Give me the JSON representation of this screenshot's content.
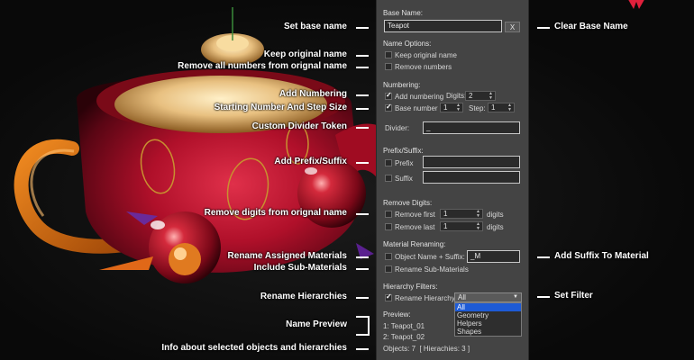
{
  "annotations_left": [
    "Set base name",
    "Keep original name",
    "Remove all numbers from orignal name",
    "Add Numbering",
    "Starting Number And Step Size",
    "Custom Divider Token",
    "Add Prefix/Suffix",
    "Remove digits from orignal name",
    "Rename Assigned Materials",
    "Include Sub-Materials",
    "Rename Hierarchies",
    "Name Preview",
    "Info about selected objects and hierarchies"
  ],
  "annotations_right": [
    "Clear Base Name",
    "Add Suffix To Material",
    "Set Filter"
  ],
  "panel": {
    "base_name_label": "Base Name:",
    "base_name_value": "Teapot",
    "clear_button": "X",
    "name_options_label": "Name Options:",
    "keep_original_label": "Keep original name",
    "keep_original_checked": false,
    "remove_numbers_label": "Remove numbers",
    "remove_numbers_checked": false,
    "numbering_label": "Numbering:",
    "add_numbering_label": "Add numbering",
    "add_numbering_checked": true,
    "digits_label": "Digits:",
    "digits_value": "2",
    "base_number_label": "Base number",
    "base_number_checked": true,
    "base_number_value": "1",
    "step_label": "Step:",
    "step_value": "1",
    "divider_label": "Divider:",
    "divider_value": "_",
    "prefix_suffix_label": "Prefix/Suffix:",
    "prefix_label": "Prefix",
    "prefix_checked": false,
    "prefix_value": "",
    "suffix_label": "Suffix",
    "suffix_checked": false,
    "suffix_value": "",
    "remove_digits_label": "Remove Digits:",
    "remove_first_label": "Remove first",
    "remove_first_checked": false,
    "remove_first_value": "1",
    "remove_last_label": "Remove last",
    "remove_last_checked": false,
    "remove_last_value": "1",
    "digits_unit": "digits",
    "material_renaming_label": "Material Renaming:",
    "object_name_suffix_label": "Object Name + Suffix:",
    "object_name_suffix_checked": false,
    "material_suffix_value": "_M",
    "rename_sub_materials_label": "Rename Sub-Materials",
    "rename_sub_materials_checked": false,
    "hierarchy_filters_label": "Hierarchy Filters:",
    "rename_hierarchy_label": "Rename Hierarchy",
    "rename_hierarchy_checked": true,
    "filter_selected": "All",
    "filter_options": [
      "All",
      "Geometry",
      "Helpers",
      "Shapes"
    ],
    "preview_label": "Preview:",
    "preview_lines": [
      "1: Teapot_01",
      "2: Teapot_02"
    ],
    "info_text": "Objects: 7  [ Hierachies: 3 ]"
  },
  "colors": {
    "panel_bg": "#444444",
    "field_bg": "#2b2b2b",
    "selection_blue": "#1e5bd6",
    "teapot_red": "#b8102a",
    "lid_gold": "#d9a24a"
  }
}
